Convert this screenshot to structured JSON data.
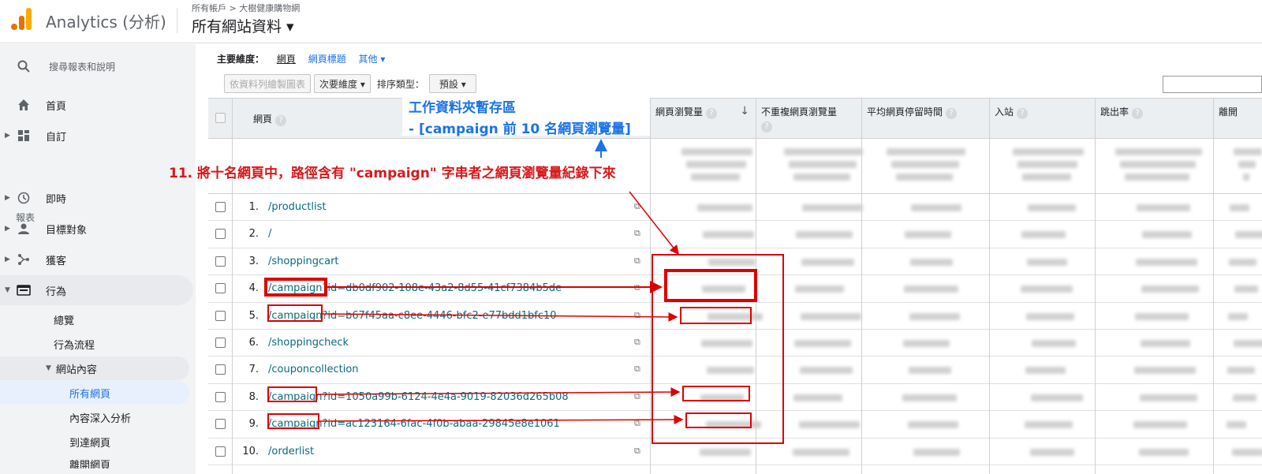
{
  "header": {
    "app_title": "Analytics (分析)",
    "breadcrumb": "所有帳戶 > 大樹健康購物網",
    "view_name": "所有網站資料 ▾"
  },
  "sidebar": {
    "search_label": "搜尋報表和說明",
    "home": "首頁",
    "customize": "自訂",
    "section_reports": "報表",
    "realtime": "即時",
    "audience": "目標對象",
    "acquisition": "獲客",
    "behavior": "行為",
    "behavior_overview": "總覽",
    "behavior_flow": "行為流程",
    "site_content": "網站內容",
    "all_pages": "所有網頁",
    "content_drilldown": "內容深入分析",
    "landing_pages": "到達網頁",
    "exit_pages": "離開網頁"
  },
  "dimension_bar": {
    "label": "主要維度：",
    "page": "網頁",
    "page_title": "網頁標題",
    "other": "其他 ▾"
  },
  "toolbar": {
    "plot_rows": "依資料列繪製圖表",
    "secondary_dim": "次要維度 ▾",
    "sort_type_label": "排序類型：",
    "sort_default": "預設 ▾"
  },
  "table": {
    "columns": [
      "網頁",
      "網頁瀏覽量",
      "不重複網頁瀏覽量",
      "平均網頁停留時間",
      "入站",
      "跳出率",
      "離開"
    ],
    "rows": [
      {
        "num": "1.",
        "page": "/productlist"
      },
      {
        "num": "2.",
        "page": "/"
      },
      {
        "num": "3.",
        "page": "/shoppingcart"
      },
      {
        "num": "4.",
        "page": "/campaign?id=db0df902-108e-43a2-8d55-41cf7384b5de"
      },
      {
        "num": "5.",
        "page": "/campaign?id=b67f45aa-c8ee-4446-bfc2-e77bdd1bfc10"
      },
      {
        "num": "6.",
        "page": "/shoppingcheck"
      },
      {
        "num": "7.",
        "page": "/couponcollection"
      },
      {
        "num": "8.",
        "page": "/campaign?id=1050a99b-6124-4e4a-9019-82036d265b08"
      },
      {
        "num": "9.",
        "page": "/campaign?id=ac123164-6fac-4f0b-abaa-29845e8e1061"
      },
      {
        "num": "10.",
        "page": "/orderlist"
      }
    ]
  },
  "annotations": {
    "workspace_title": "工作資料夾暫存區",
    "workspace_sub": "- [campaign 前 10 名網頁瀏覽量]",
    "instruction": "11. 將十名網頁中，路徑含有 \"campaign\" 字串者之網頁瀏覽量紀錄下來",
    "box_color": "#d00000",
    "workspace_color": "#1a73e8"
  }
}
